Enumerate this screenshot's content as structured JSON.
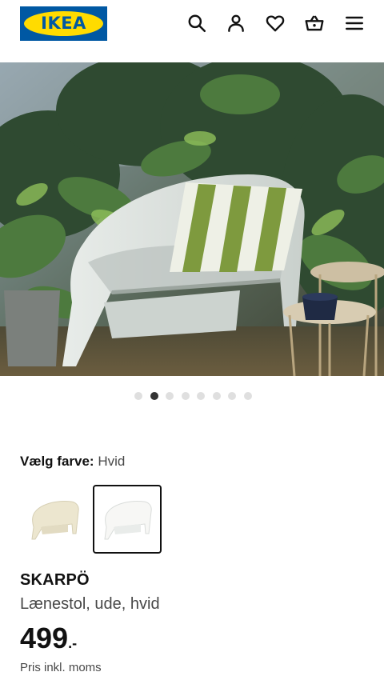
{
  "header": {
    "logo_text": "IKEA",
    "icons": [
      "search-icon",
      "account-icon",
      "heart-icon",
      "basket-icon",
      "menu-icon"
    ]
  },
  "gallery": {
    "image": "photo-white-outdoor-armchair-with-striped-cushion-among-plants",
    "dot_count": 8,
    "active_index": 1
  },
  "color_picker": {
    "label": "Vælg farve:",
    "selected_value": "Hvid",
    "options": [
      {
        "name": "beige",
        "color": "#eeead8"
      },
      {
        "name": "white",
        "color": "#f6f6f4"
      }
    ],
    "selected_index": 1
  },
  "product": {
    "name": "SKARPÖ",
    "description": "Lænestol, ude, hvid",
    "price": "499",
    "price_suffix": ".-",
    "vat_note": "Pris inkl. moms"
  },
  "colors": {
    "brand_blue": "#0058a3",
    "brand_yellow": "#ffdb00",
    "dot_active": "#333333",
    "dot_inactive": "#dfdfdf"
  }
}
